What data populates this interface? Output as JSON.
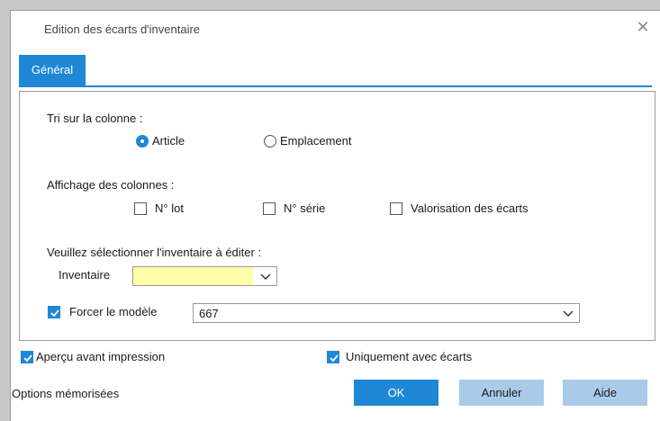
{
  "window": {
    "title": "Edition des écarts d'inventaire",
    "close_glyph": "✕"
  },
  "tabs": [
    {
      "label": "Général",
      "active": true
    }
  ],
  "sort": {
    "label": "Tri sur la colonne :",
    "options": [
      {
        "label": "Article",
        "selected": true
      },
      {
        "label": "Emplacement",
        "selected": false
      }
    ]
  },
  "columns": {
    "label": "Affichage des colonnes :",
    "options": [
      {
        "label": "N° lot",
        "checked": false
      },
      {
        "label": "N° série",
        "checked": false
      },
      {
        "label": "Valorisation des écarts",
        "checked": false
      }
    ]
  },
  "inventory": {
    "prompt": "Veuillez sélectionner l'inventaire à éditer :",
    "field_label": "Inventaire",
    "field_value": "",
    "field_bg": "#ffffa8"
  },
  "model": {
    "label": "Forcer le modèle",
    "checked": true,
    "value": "667"
  },
  "options": {
    "preview": {
      "label": "Aperçu avant impression",
      "checked": true
    },
    "only_gaps": {
      "label": "Uniquement avec écarts",
      "checked": true
    }
  },
  "footer": {
    "saved_options": "Options mémorisées",
    "ok": "OK",
    "cancel": "Annuler",
    "help": "Aide"
  },
  "colors": {
    "accent": "#1e87d6",
    "secondary_button": "#a9cbe9"
  }
}
